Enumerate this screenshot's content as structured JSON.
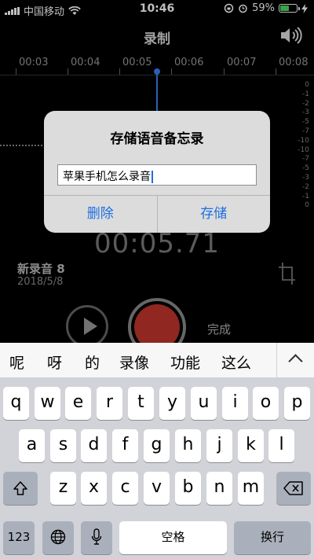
{
  "status": {
    "carrier": "中国移动",
    "time": "10:46",
    "battery_percent": "59%",
    "battery_level": 0.59,
    "accent_green": "#4cd964"
  },
  "recorder": {
    "title": "录制",
    "ticks": [
      "00:03",
      "00:04",
      "00:05",
      "00:06",
      "00:07",
      "00:08"
    ],
    "db_scale": [
      "0",
      "-1",
      "-2",
      "-3",
      "-5",
      "-7",
      "-10",
      "-10",
      "-7",
      "-5",
      "-3",
      "-2",
      "-1",
      "0"
    ],
    "timer": "00:05.71",
    "recording_name": "新录音 8",
    "recording_date": "2018/5/8",
    "done_label": "完成",
    "record_color": "#c0342b"
  },
  "alert": {
    "title": "存储语音备忘录",
    "input_value": "苹果手机怎么录音",
    "delete_label": "删除",
    "save_label": "存储",
    "accent": "#1f6fe0"
  },
  "suggestions": [
    "呢",
    "呀",
    "的",
    "录像",
    "功能",
    "这么"
  ],
  "keyboard": {
    "row1": [
      "q",
      "w",
      "e",
      "r",
      "t",
      "y",
      "u",
      "i",
      "o",
      "p"
    ],
    "row2": [
      "a",
      "s",
      "d",
      "f",
      "g",
      "h",
      "j",
      "k",
      "l"
    ],
    "row3": [
      "z",
      "x",
      "c",
      "v",
      "b",
      "n",
      "m"
    ],
    "numbers_label": "123",
    "space_label": "空格",
    "return_label": "换行"
  }
}
